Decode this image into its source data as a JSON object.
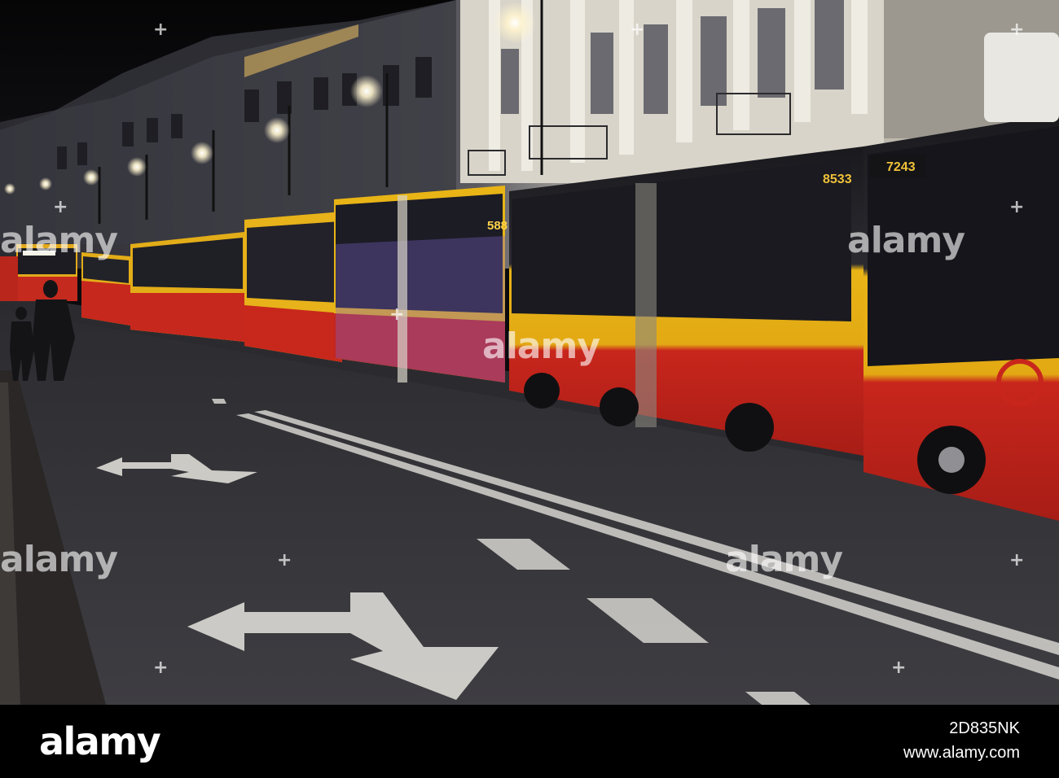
{
  "scene": {
    "subject": "night street with a line of parked red-and-yellow articulated buses",
    "colors": {
      "sky": "#0a0a0c",
      "road": "#3a3a3d",
      "bus_yellow": "#e8b416",
      "bus_red": "#c8261c",
      "facade_lit": "#d9d6cc",
      "street_light": "#fff6d8"
    },
    "bus_numbers": {
      "front_bus": "7243",
      "second_bus": "8533",
      "third_bus": "588",
      "far_bus_sign": "ZAJAZDOWA E-2"
    }
  },
  "watermark": {
    "text": "alamy",
    "plus": "+"
  },
  "footer": {
    "logo": "alamy",
    "image_id": "2D835NK",
    "site": "www.alamy.com"
  }
}
